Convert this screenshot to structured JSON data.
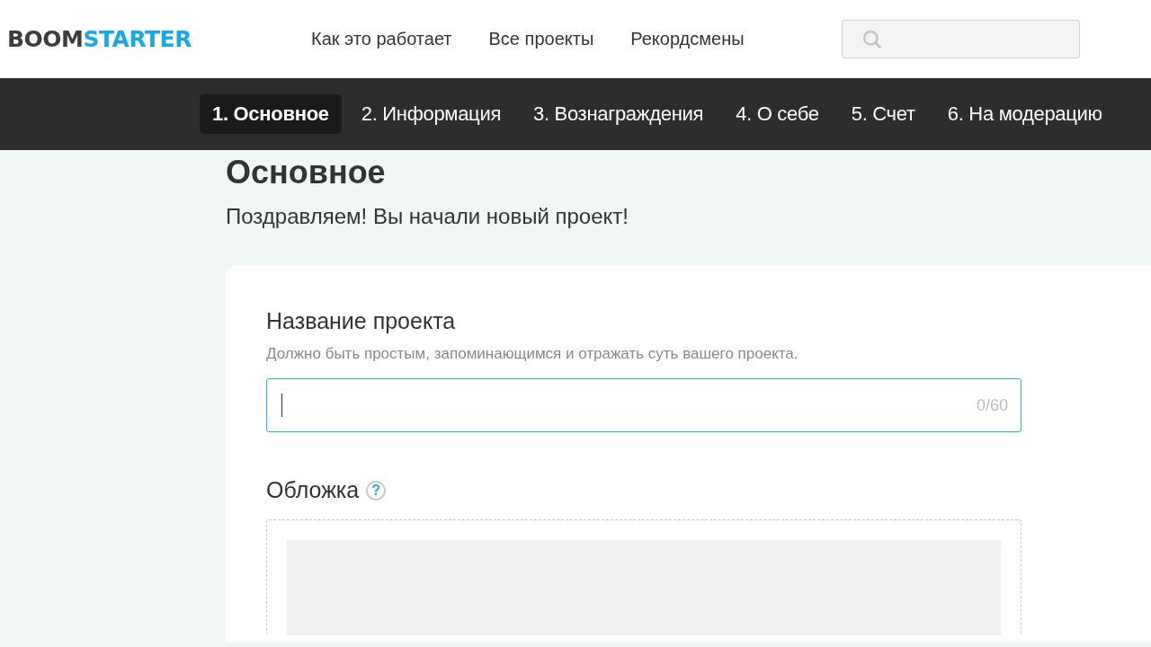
{
  "header": {
    "logo": {
      "dark_part": "BOOM",
      "accent_part": "STARTER"
    },
    "nav_links": [
      "Как это работает",
      "Все проекты",
      "Рекордсмены"
    ]
  },
  "steps": [
    {
      "label": "1. Основное",
      "selected": true
    },
    {
      "label": "2. Информация",
      "selected": false
    },
    {
      "label": "3. Вознаграждения",
      "selected": false
    },
    {
      "label": "4. О себе",
      "selected": false
    },
    {
      "label": "5. Счет",
      "selected": false
    },
    {
      "label": "6. На модерацию",
      "selected": false
    }
  ],
  "page": {
    "title": "Основное",
    "subtitle": "Поздравляем! Вы начали новый проект!"
  },
  "form": {
    "name_field": {
      "label": "Название проекта",
      "hint": "Должно быть простым, запоминающимся и отражать суть вашего проекта.",
      "counter": "0/60",
      "focused": true
    },
    "cover": {
      "label": "Обложка",
      "help": "?"
    }
  }
}
